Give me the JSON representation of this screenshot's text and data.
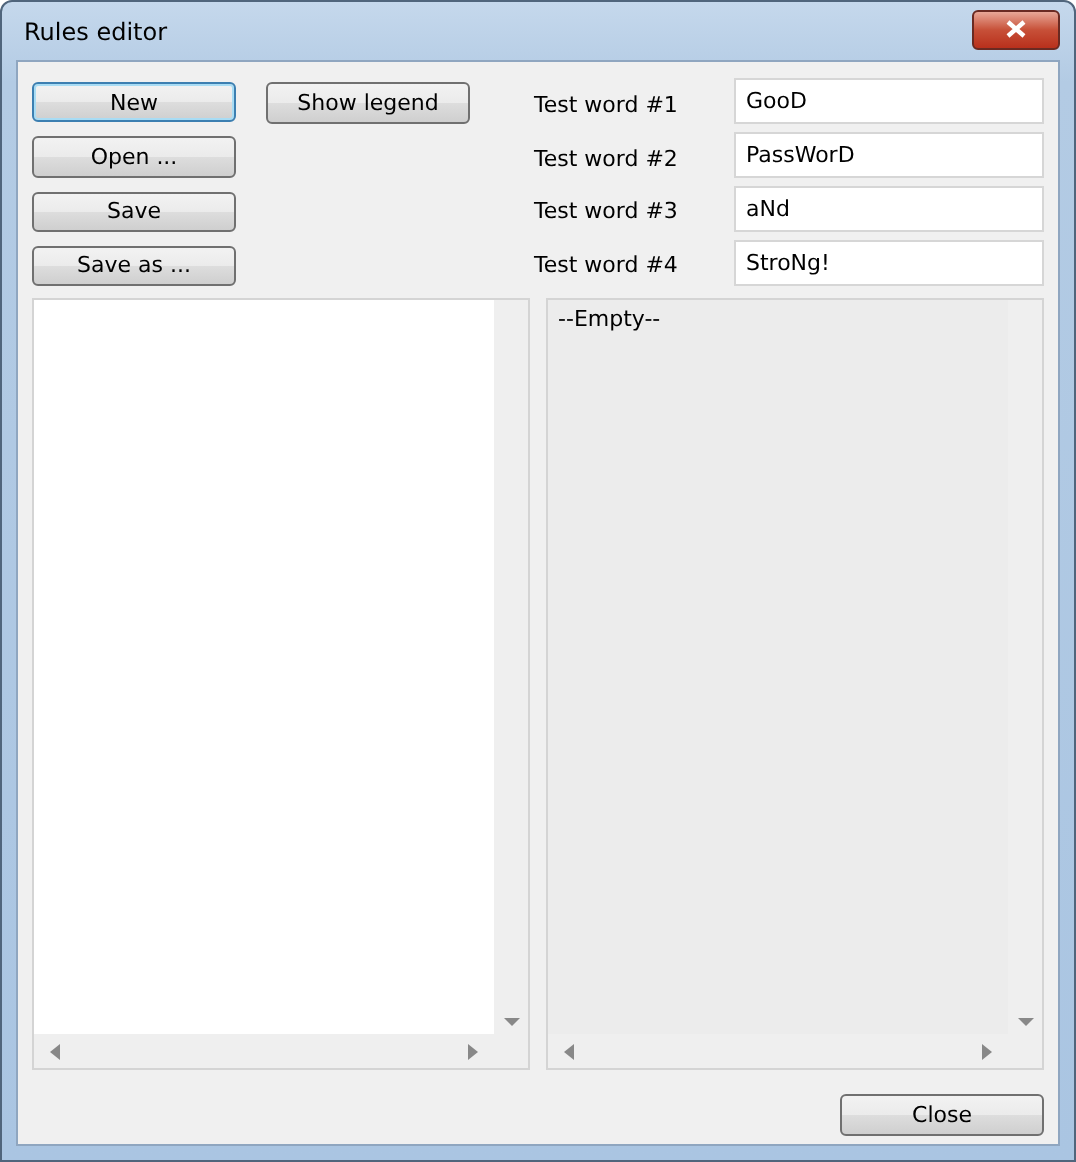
{
  "window": {
    "title": "Rules editor"
  },
  "buttons": [
    {
      "label": "New",
      "selected": true
    },
    {
      "label": "Open ...",
      "selected": false
    },
    {
      "label": "Save",
      "selected": false
    },
    {
      "label": "Save as ...",
      "selected": false
    }
  ],
  "legend_button": {
    "label": "Show legend"
  },
  "test_words": [
    {
      "label": "Test word #1",
      "value": "GooD"
    },
    {
      "label": "Test word #2",
      "value": "PassWorD"
    },
    {
      "label": "Test word #3",
      "value": "aNd"
    },
    {
      "label": "Test word #4",
      "value": "StroNg!"
    }
  ],
  "left_list": {
    "disabled": false
  },
  "right_list": {
    "text": "--Empty--",
    "disabled": true
  },
  "close_button": {
    "label": "Close"
  }
}
